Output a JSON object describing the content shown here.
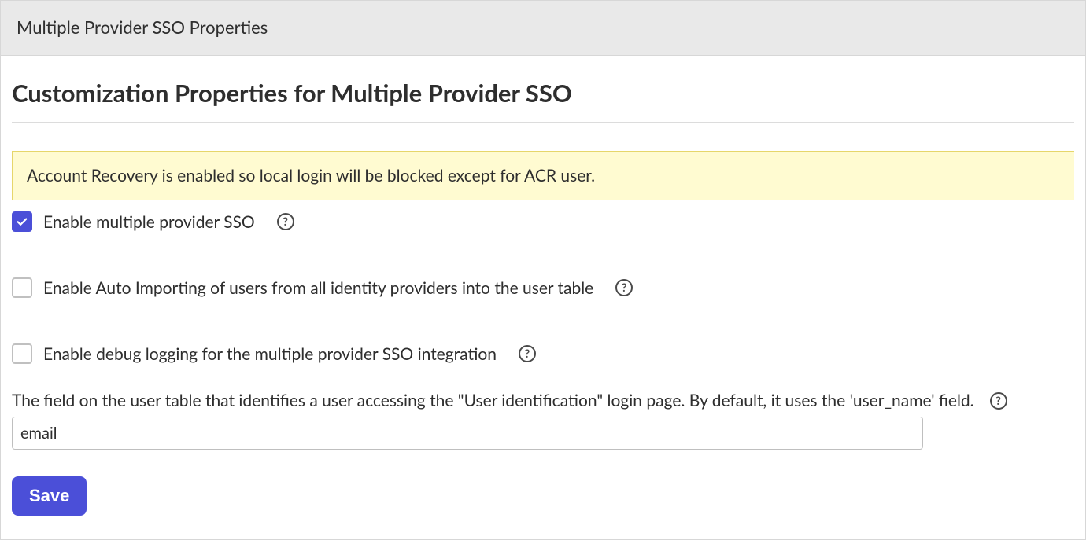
{
  "header": {
    "title": "Multiple Provider SSO Properties"
  },
  "page": {
    "heading": "Customization Properties for Multiple Provider SSO"
  },
  "alert": {
    "message": "Account Recovery is enabled so local login will be blocked except for ACR user."
  },
  "options": {
    "enable_sso": {
      "label": "Enable multiple provider SSO",
      "checked": true
    },
    "enable_auto_import": {
      "label": "Enable Auto Importing of users from all identity providers into the user table",
      "checked": false
    },
    "enable_debug": {
      "label": "Enable debug logging for the multiple provider SSO integration",
      "checked": false
    }
  },
  "identification_field": {
    "label": "The field on the user table that identifies a user accessing the \"User identification\" login page. By default, it uses the 'user_name' field.",
    "value": "email"
  },
  "actions": {
    "save_label": "Save"
  },
  "help_glyph": "?"
}
